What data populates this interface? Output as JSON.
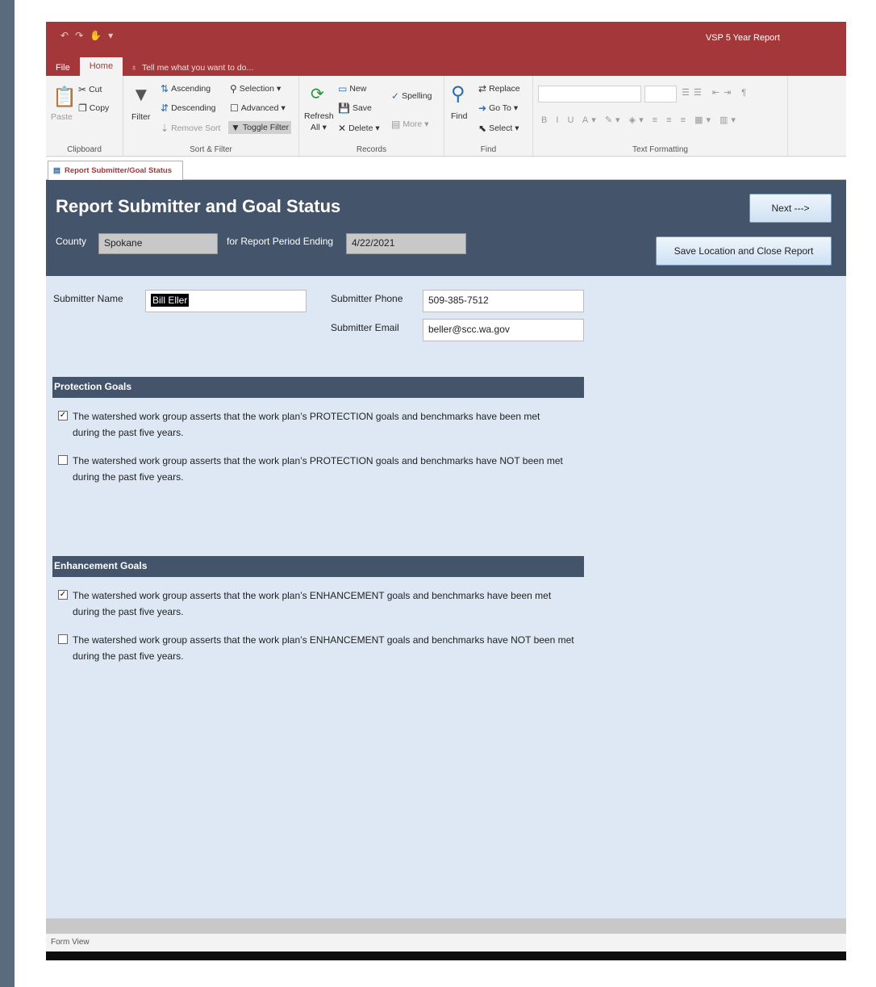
{
  "app": {
    "title": "VSP 5 Year Report",
    "qat_icons": [
      "undo-icon",
      "redo-icon",
      "touch-mode-icon",
      "customize-icon"
    ],
    "tabs": {
      "file": "File",
      "home": "Home",
      "tell_me": "Tell me what you want to do..."
    }
  },
  "ribbon": {
    "clipboard": {
      "label": "Clipboard",
      "paste": "Paste",
      "cut": "Cut",
      "copy": "Copy"
    },
    "sort_filter": {
      "label": "Sort & Filter",
      "filter": "Filter",
      "ascending": "Ascending",
      "descending": "Descending",
      "remove_sort": "Remove Sort",
      "selection": "Selection",
      "advanced": "Advanced",
      "toggle_filter": "Toggle Filter"
    },
    "records": {
      "label": "Records",
      "refresh": "Refresh",
      "refresh_all": "All",
      "new": "New",
      "save": "Save",
      "delete": "Delete",
      "spelling": "Spelling",
      "more": "More"
    },
    "find": {
      "label": "Find",
      "find": "Find",
      "replace": "Replace",
      "go_to": "Go To",
      "select": "Select"
    },
    "text_formatting": {
      "label": "Text Formatting"
    }
  },
  "doc_tab": {
    "label": "Report Submitter/Goal Status"
  },
  "form": {
    "title": "Report Submitter and Goal Status",
    "county_label": "County",
    "county_value": "Spokane",
    "period_label": "for Report Period Ending",
    "period_value": "4/22/2021",
    "next_button": "Next --->",
    "save_close_button": "Save Location and Close Report",
    "submitter_name_label": "Submitter Name",
    "submitter_name_value": "Bill Eller",
    "submitter_phone_label": "Submitter Phone",
    "submitter_phone_value": "509-385-7512",
    "submitter_email_label": "Submitter Email",
    "submitter_email_value": "beller@scc.wa.gov",
    "protection": {
      "heading": "Protection Goals",
      "options": [
        {
          "checked": true,
          "line1": "The watershed work group asserts that the work plan’s PROTECTION goals and benchmarks have been met",
          "line2": "during the past five years."
        },
        {
          "checked": false,
          "line1": "The watershed work group asserts that the work plan’s PROTECTION goals and benchmarks have NOT been met",
          "line2": "during the past five years."
        }
      ]
    },
    "enhancement": {
      "heading": "Enhancement Goals",
      "options": [
        {
          "checked": true,
          "line1": "The watershed work group asserts that the work plan’s ENHANCEMENT goals and benchmarks have been met",
          "line2": "during the past five years."
        },
        {
          "checked": false,
          "line1": "The watershed work group asserts that the work plan’s ENHANCEMENT goals and benchmarks have NOT been met",
          "line2": "during the past five years."
        }
      ]
    }
  },
  "status_bar": {
    "view": "Form View"
  }
}
